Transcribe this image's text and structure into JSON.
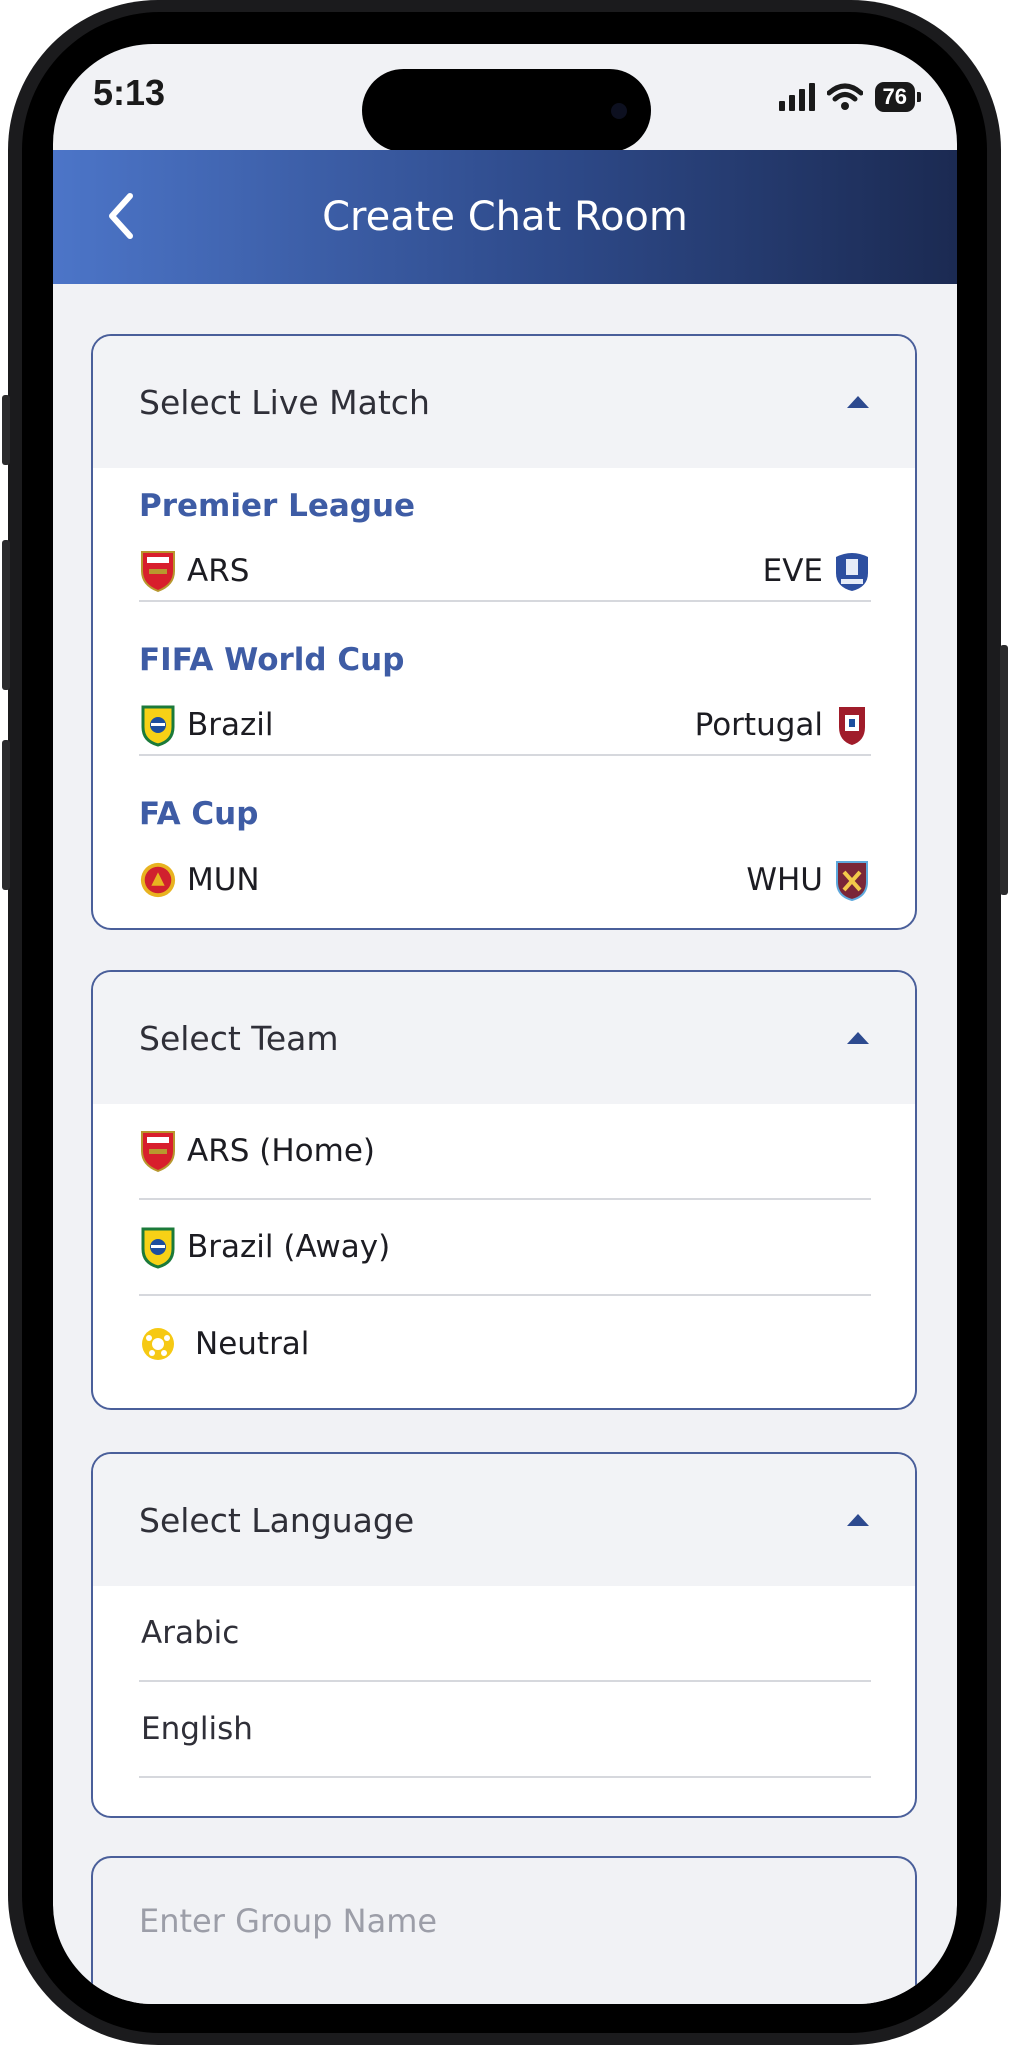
{
  "status_bar": {
    "time": "5:13",
    "battery": "76"
  },
  "header": {
    "title": "Create Chat Room",
    "back_icon": "chevron-left-icon"
  },
  "live_match": {
    "label": "Select Live Match",
    "groups": [
      {
        "league": "Premier League",
        "home": "ARS",
        "away": "EVE"
      },
      {
        "league": "FIFA World Cup",
        "home": "Brazil",
        "away": "Portugal"
      },
      {
        "league": "FA Cup",
        "home": "MUN",
        "away": "WHU"
      }
    ]
  },
  "team": {
    "label": "Select Team",
    "options": [
      "ARS (Home)",
      "Brazil (Away)",
      "Neutral"
    ]
  },
  "language": {
    "label": "Select Language",
    "options": [
      "Arabic",
      "English"
    ]
  },
  "group_name": {
    "placeholder": "Enter Group Name"
  },
  "colors": {
    "accent": "#3e5ca5",
    "header_start": "#4c75c8",
    "header_end": "#1b2a52",
    "border": "#4a5f9a"
  }
}
